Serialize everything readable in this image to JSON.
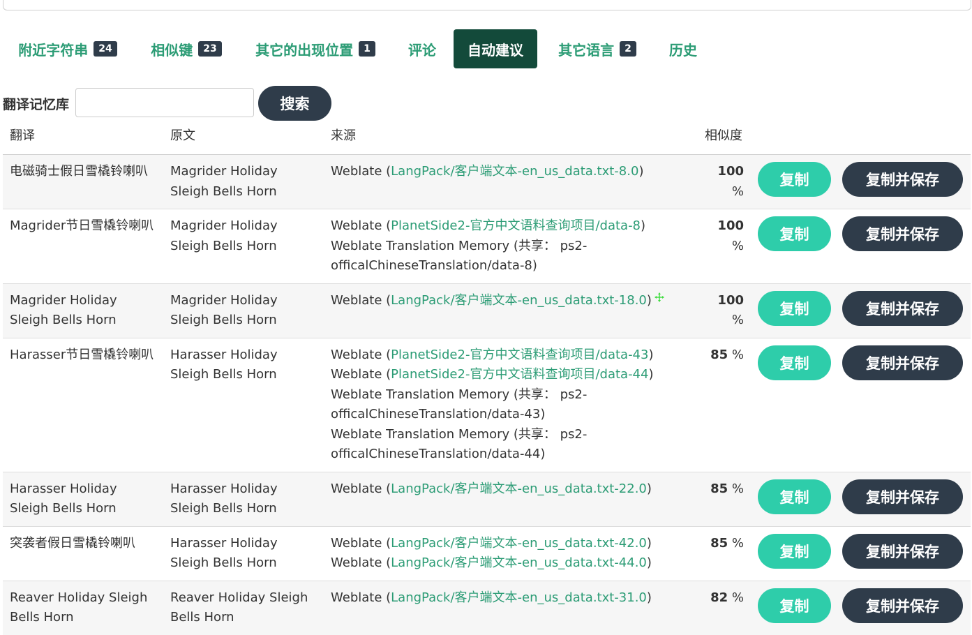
{
  "tabs": [
    {
      "label": "附近字符串",
      "badge": "24"
    },
    {
      "label": "相似键",
      "badge": "23"
    },
    {
      "label": "其它的出现位置",
      "badge": "1"
    },
    {
      "label": "评论",
      "badge": ""
    },
    {
      "label": "自动建议",
      "badge": "",
      "active": true
    },
    {
      "label": "其它语言",
      "badge": "2"
    },
    {
      "label": "历史",
      "badge": ""
    }
  ],
  "search": {
    "label": "翻译记忆库",
    "placeholder": "",
    "button": "搜索"
  },
  "table": {
    "headers": {
      "translation": "翻译",
      "source": "原文",
      "origin": "来源",
      "similarity": "相似度"
    },
    "copy_label": "复制",
    "save_label": "复制并保存",
    "rows": [
      {
        "translation": "电磁骑士假日雪橇铃喇叭",
        "source": "Magrider Holiday Sleigh Bells Horn",
        "similarity": "100",
        "unit": "%",
        "origins": [
          {
            "prefix": "Weblate (",
            "link": "LangPack/客户端文本-en_us_data.txt-8.0",
            "suffix": ")"
          }
        ]
      },
      {
        "translation": "Magrider节日雪橇铃喇叭",
        "source": "Magrider Holiday Sleigh Bells Horn",
        "similarity": "100",
        "unit": "%",
        "origins": [
          {
            "prefix": "Weblate (",
            "link": "PlanetSide2-官方中文语料查询项目/data-8",
            "suffix": ")"
          },
          {
            "prefix": "Weblate Translation Memory (共享： ps2-officalChineseTranslation/data-8)",
            "link": "",
            "suffix": ""
          }
        ]
      },
      {
        "translation": "Magrider Holiday Sleigh Bells Horn",
        "source": "Magrider Holiday Sleigh Bells Horn",
        "similarity": "100",
        "unit": "%",
        "origins": [
          {
            "prefix": "Weblate (",
            "link": "LangPack/客户端文本-en_us_data.txt-18.0",
            "suffix": ")"
          }
        ]
      },
      {
        "translation": "Harasser节日雪橇铃喇叭",
        "source": "Harasser Holiday Sleigh Bells Horn",
        "similarity": "85",
        "unit": "%",
        "origins": [
          {
            "prefix": "Weblate (",
            "link": "PlanetSide2-官方中文语料查询项目/data-43",
            "suffix": ")"
          },
          {
            "prefix": "Weblate (",
            "link": "PlanetSide2-官方中文语料查询项目/data-44",
            "suffix": ")"
          },
          {
            "prefix": "Weblate Translation Memory (共享： ps2-officalChineseTranslation/data-43)",
            "link": "",
            "suffix": ""
          },
          {
            "prefix": "Weblate Translation Memory (共享： ps2-officalChineseTranslation/data-44)",
            "link": "",
            "suffix": ""
          }
        ]
      },
      {
        "translation": "Harasser Holiday Sleigh Bells Horn",
        "source": "Harasser Holiday Sleigh Bells Horn",
        "similarity": "85",
        "unit": "%",
        "origins": [
          {
            "prefix": "Weblate (",
            "link": "LangPack/客户端文本-en_us_data.txt-22.0",
            "suffix": ")"
          }
        ]
      },
      {
        "translation": "突袭者假日雪橇铃喇叭",
        "source": "Harasser Holiday Sleigh Bells Horn",
        "similarity": "85",
        "unit": "%",
        "origins": [
          {
            "prefix": "Weblate (",
            "link": "LangPack/客户端文本-en_us_data.txt-42.0",
            "suffix": ")"
          },
          {
            "prefix": "Weblate (",
            "link": "LangPack/客户端文本-en_us_data.txt-44.0",
            "suffix": ")"
          }
        ]
      },
      {
        "translation": "Reaver Holiday Sleigh Bells Horn",
        "source": "Reaver Holiday Sleigh Bells Horn",
        "similarity": "82",
        "unit": "%",
        "origins": [
          {
            "prefix": "Weblate (",
            "link": "LangPack/客户端文本-en_us_data.txt-31.0",
            "suffix": ")"
          }
        ]
      }
    ]
  }
}
